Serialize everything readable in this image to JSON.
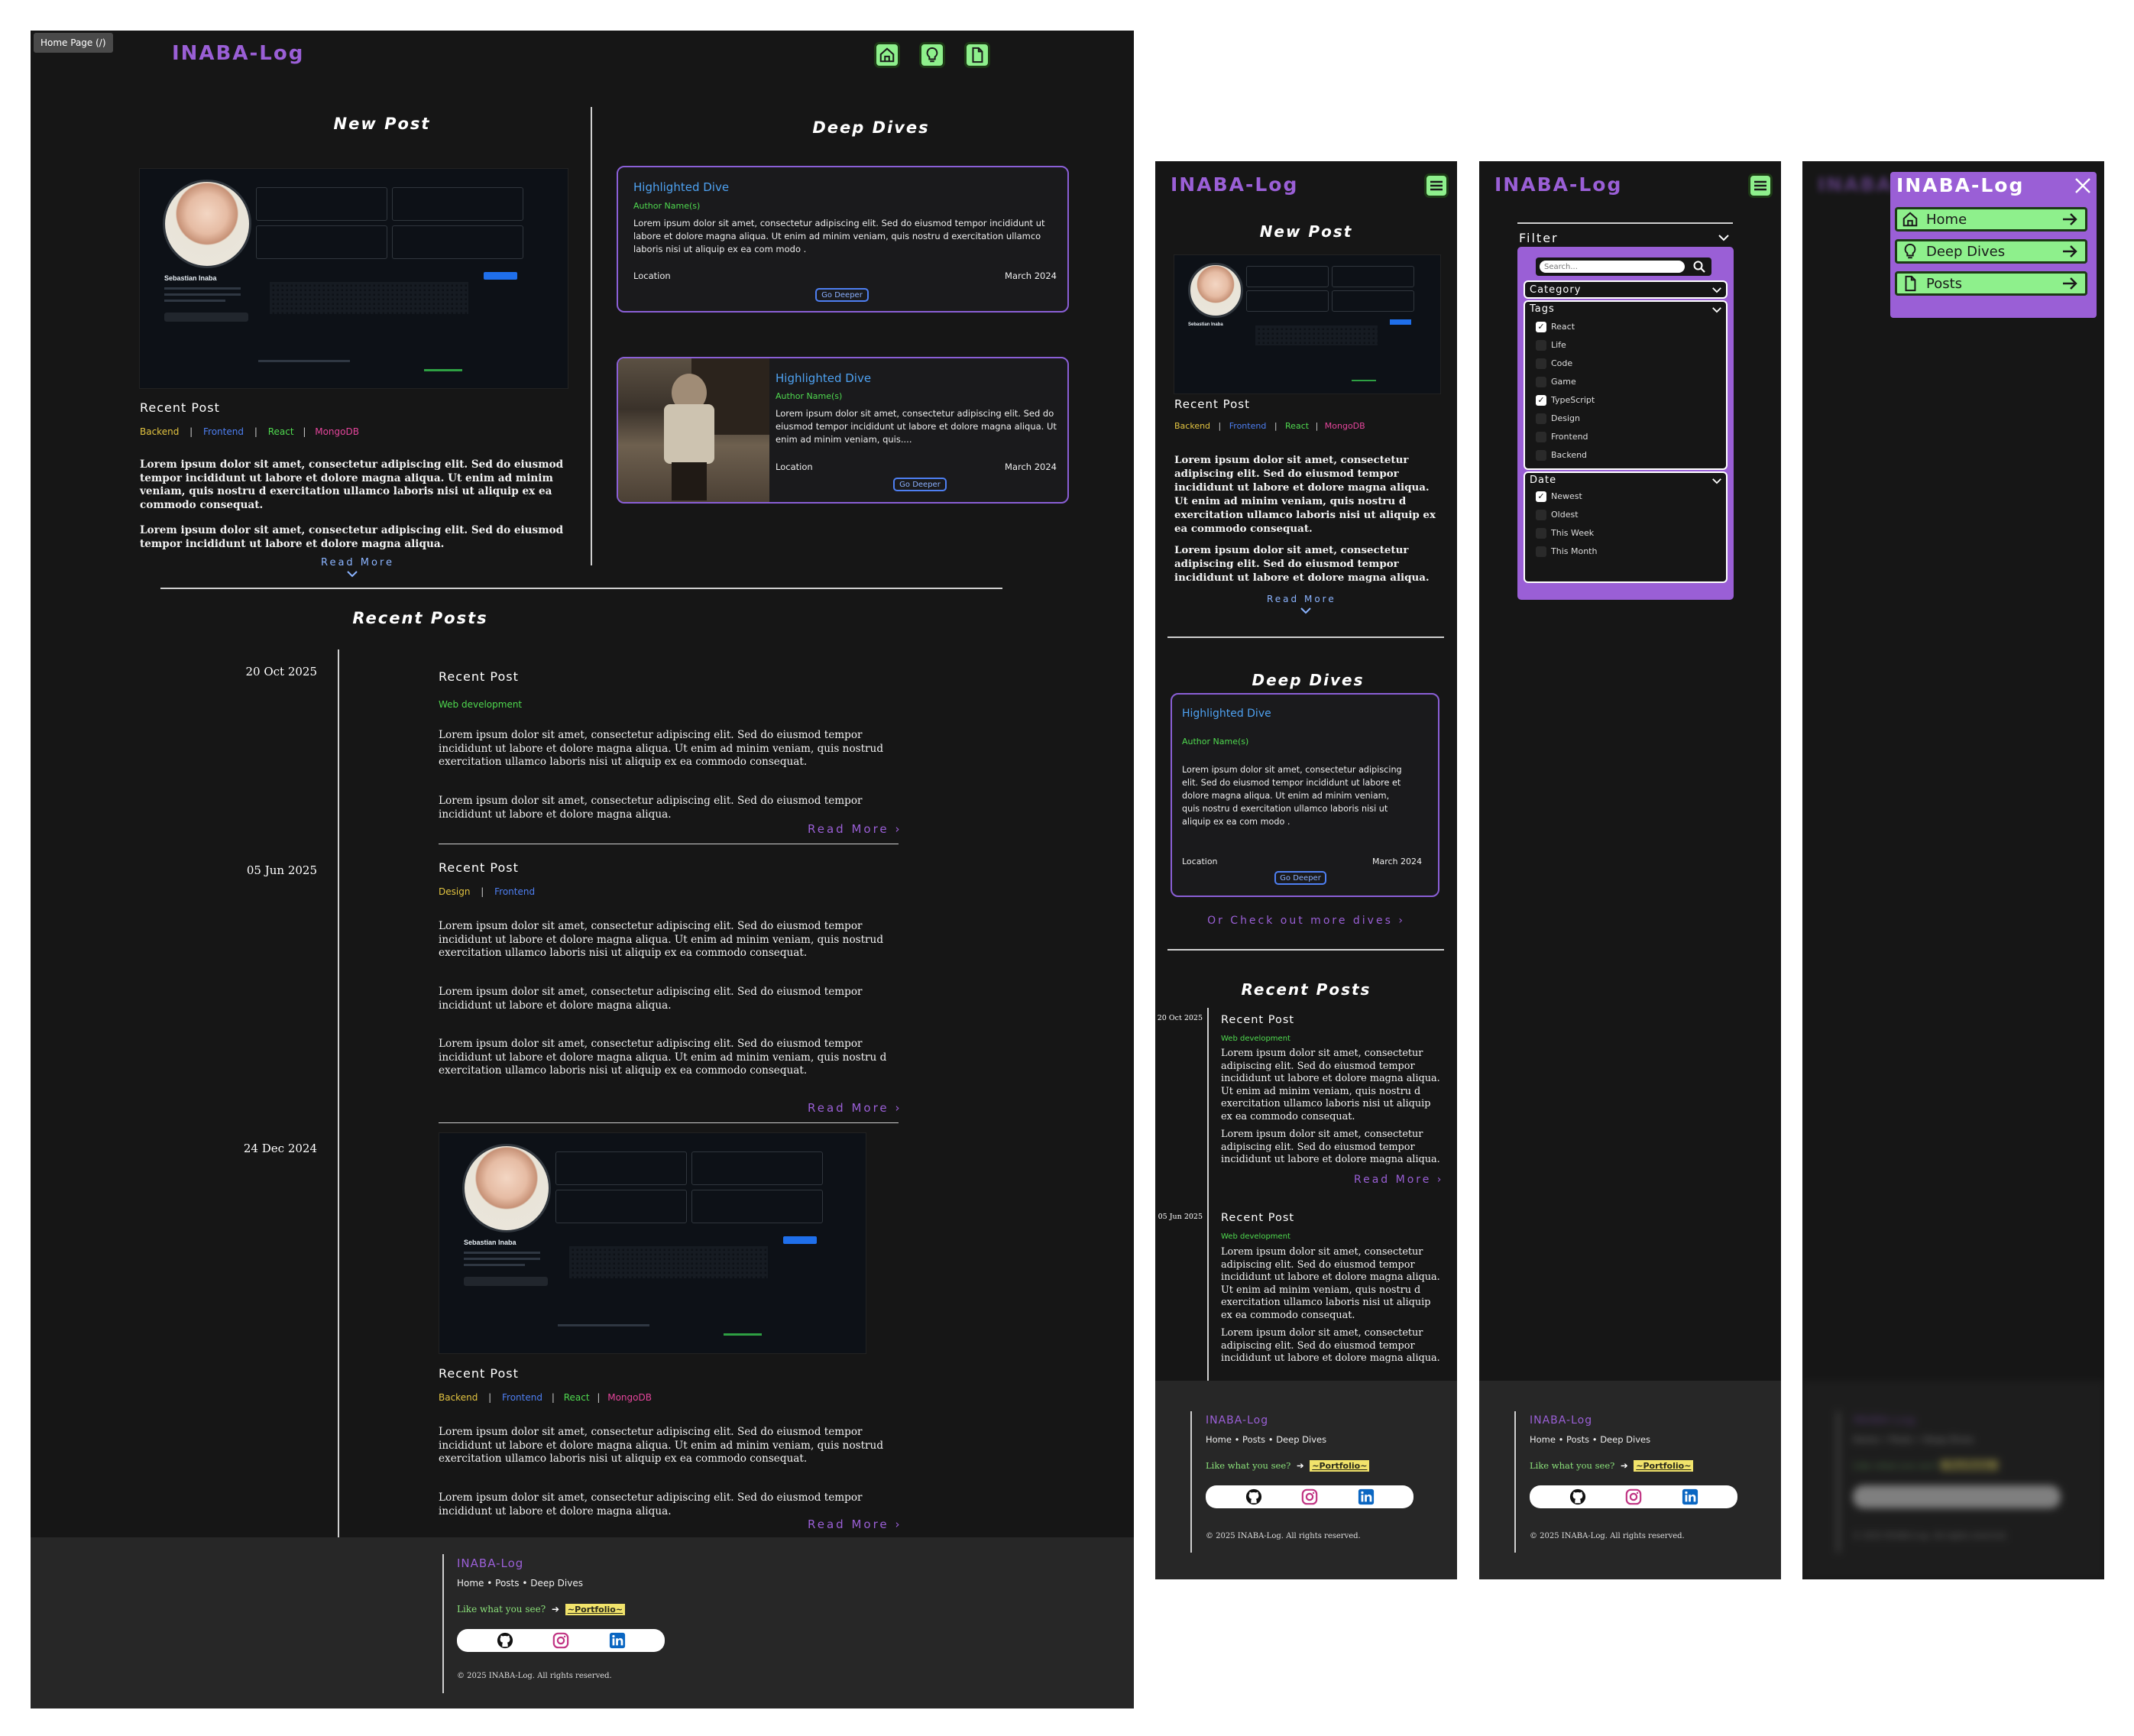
{
  "tooltip": "Home Page (/)",
  "logo": "INABA-Log",
  "nav_icons": [
    "home-icon",
    "lightbulb-icon",
    "document-icon"
  ],
  "new_post": {
    "heading": "New Post",
    "profile": {
      "name": "Sebastian Inaba"
    },
    "title": "Recent Post",
    "tags": [
      "Backend",
      "Frontend",
      "React",
      "MongoDB"
    ],
    "sep": "|",
    "paragraphs": [
      "Lorem ipsum dolor sit amet, consectetur adipiscing elit. Sed do eiusmod tempor incididunt ut labore et dolore magna aliqua. Ut enim ad minim veniam, quis nostru d exercitation ullamco laboris nisi ut aliquip ex ea commodo consequat.",
      "Lorem ipsum dolor sit amet, consectetur adipiscing elit. Sed do eiusmod tempor incididunt ut labore et dolore magna aliqua."
    ],
    "read_more": "Read More"
  },
  "deep_dives": {
    "heading": "Deep Dives",
    "cards": [
      {
        "title": "Highlighted Dive",
        "author": "Author Name(s)",
        "body": "Lorem ipsum dolor sit amet, consectetur adipiscing elit. Sed do eiusmod tempor incididunt ut labore et dolore magna aliqua. Ut enim ad minim veniam, quis nostru d exercitation ullamco laboris nisi ut aliquip ex ea com modo  .",
        "location": "Location",
        "date": "March 2024",
        "button": "Go Deeper"
      },
      {
        "title": "Highlighted Dive",
        "author": "Author Name(s)",
        "body": "Lorem ipsum dolor sit amet, consectetur adipiscing elit. Sed do eiusmod tempor incididunt ut labore et dolore magna aliqua. Ut enim ad minim veniam, quis....",
        "location": "Location",
        "date": "March 2024",
        "button": "Go Deeper"
      }
    ],
    "more_link": "Or Check out more dives"
  },
  "recent_posts": {
    "heading": "Recent Posts",
    "posts": [
      {
        "date": "20 Oct 2025",
        "title": "Recent Post",
        "tags": [
          "Web development"
        ],
        "paragraphs": [
          "Lorem ipsum dolor sit amet, consectetur adipiscing elit. Sed do eiusmod tempor incididunt ut labore et dolore magna aliqua. Ut enim ad minim veniam, quis nostrud exercitation ullamco laboris nisi ut aliquip ex ea commodo consequat.",
          "Lorem ipsum dolor sit amet, consectetur adipiscing elit. Sed do eiusmod tempor incididunt ut labore et dolore magna aliqua."
        ],
        "read_more": "Read More"
      },
      {
        "date": "05 Jun 2025",
        "title": "Recent Post",
        "tags": [
          "Design",
          "Frontend"
        ],
        "paragraphs": [
          "Lorem ipsum dolor sit amet, consectetur adipiscing elit. Sed do eiusmod tempor incididunt ut labore et dolore magna aliqua. Ut enim ad minim veniam, quis nostrud exercitation ullamco laboris nisi ut aliquip ex ea commodo consequat.",
          "Lorem ipsum dolor sit amet, consectetur adipiscing elit. Sed do eiusmod tempor incididunt ut labore et dolore magna aliqua.",
          "Lorem ipsum dolor sit amet, consectetur adipiscing elit. Sed do eiusmod tempor incididunt ut labore et dolore magna aliqua. Ut enim ad minim veniam, quis nostru d exercitation ullamco laboris nisi ut aliquip ex ea commodo consequat."
        ],
        "read_more": "Read More"
      },
      {
        "date": "24 Dec 2024",
        "title": "Recent Post",
        "tags": [
          "Backend",
          "Frontend",
          "React",
          "MongoDB"
        ],
        "paragraphs": [
          "Lorem ipsum dolor sit amet, consectetur adipiscing elit. Sed do eiusmod tempor incididunt ut labore et dolore magna aliqua. Ut enim ad minim veniam, quis nostrud exercitation ullamco laboris nisi ut aliquip ex ea commodo consequat.",
          "Lorem ipsum dolor sit amet, consectetur adipiscing elit. Sed do eiusmod tempor incididunt ut labore et dolore magna aliqua."
        ],
        "read_more": "Read More"
      }
    ]
  },
  "mobile_posts": [
    {
      "date": "20 Oct 2025",
      "title": "Recent Post",
      "tag": "Web development",
      "paragraphs": [
        "Lorem ipsum dolor sit amet, consectetur adipiscing elit. Sed do eiusmod tempor incididunt ut labore et dolore magna aliqua. Ut enim ad minim veniam, quis nostru d exercitation ullamco laboris nisi ut aliquip ex ea commodo consequat.",
        "Lorem ipsum dolor sit amet, consectetur adipiscing elit. Sed do eiusmod tempor incididunt ut labore et dolore magna aliqua."
      ]
    },
    {
      "date": "05 Jun 2025",
      "title": "Recent Post",
      "tag": "Web development",
      "paragraphs": [
        "Lorem ipsum dolor sit amet, consectetur adipiscing elit. Sed do eiusmod tempor incididunt ut labore et dolore magna aliqua. Ut enim ad minim veniam, quis nostru d exercitation ullamco laboris nisi ut aliquip ex ea commodo consequat.",
        "Lorem ipsum dolor sit amet, consectetur adipiscing elit. Sed do eiusmod tempor incididunt ut labore et dolore magna aliqua."
      ]
    }
  ],
  "mobile_new_post_paragraphs": [
    "Lorem ipsum dolor sit amet, consectetur adipiscing elit. Sed do eiusmod tempor incididunt ut labore et dolore magna aliqua. Ut enim ad minim veniam, quis nostru d exercitation ullamco laboris nisi ut aliquip ex ea commodo consequat.",
    "Lorem ipsum dolor sit amet, consectetur adipiscing elit. Sed do eiusmod tempor incididunt ut labore et dolore magna aliqua."
  ],
  "mobile_dive_body": "Lorem ipsum dolor sit amet, consectetur adipiscing elit. Sed do eiusmod tempor incididunt ut labore et dolore magna aliqua. Ut enim ad minim veniam, quis nostru d exercitation ullamco laboris nisi ut aliquip ex ea com modo  .",
  "footer": {
    "logo": "INABA-Log",
    "links": "Home • Posts • Deep Dives",
    "like": "Like what you see?",
    "arrow": "➔",
    "portfolio": "~Portfolio~",
    "copyright": "© 2025 INABA-Log. All rights reserved."
  },
  "filter": {
    "title": "Filter",
    "search_placeholder": "Search...",
    "category": "Category",
    "tags_label": "Tags",
    "tags": [
      {
        "label": "React",
        "checked": true
      },
      {
        "label": "Life",
        "checked": false
      },
      {
        "label": "Code",
        "checked": false
      },
      {
        "label": "Game",
        "checked": false
      },
      {
        "label": "TypeScript",
        "checked": true
      },
      {
        "label": "Design",
        "checked": false
      },
      {
        "label": "Frontend",
        "checked": false
      },
      {
        "label": "Backend",
        "checked": false
      }
    ],
    "date_label": "Date",
    "dates": [
      {
        "label": "Newest",
        "checked": true
      },
      {
        "label": "Oldest",
        "checked": false
      },
      {
        "label": "This Week",
        "checked": false
      },
      {
        "label": "This Month",
        "checked": false
      }
    ]
  },
  "menu": {
    "items": [
      "Home",
      "Deep Dives",
      "Posts"
    ]
  },
  "colors": {
    "accent": "#9a5fd6",
    "nav_green": "#8ef08c",
    "tag_yellow": "#e3c441",
    "tag_blue": "#4e7ff2",
    "tag_green": "#4fd94f",
    "tag_pink": "#e4459b"
  }
}
